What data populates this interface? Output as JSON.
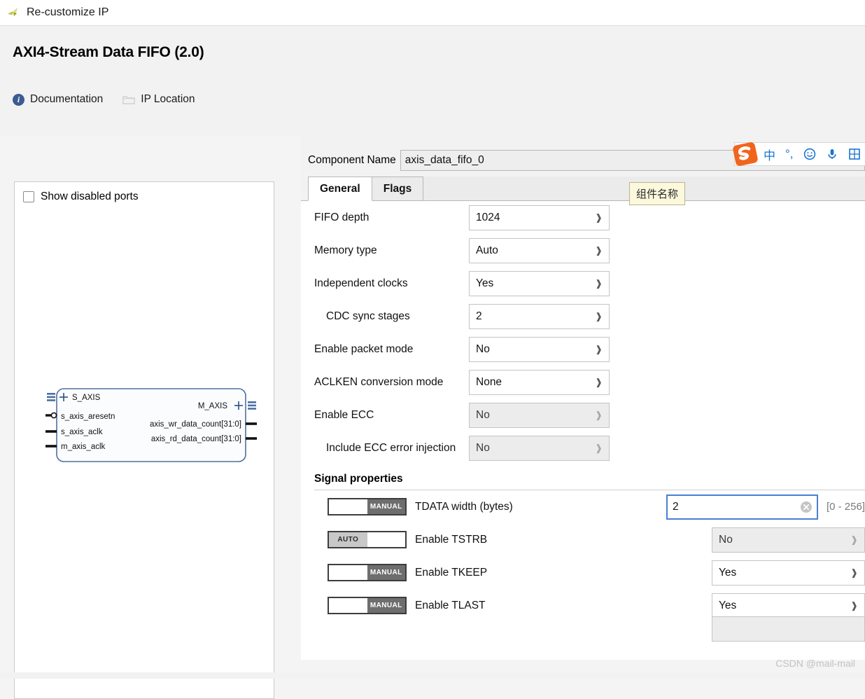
{
  "window": {
    "title": "Re-customize IP",
    "icon": "vivado-logo-icon"
  },
  "header": {
    "ip_title": "AXI4-Stream Data FIFO (2.0)",
    "links": [
      {
        "label": "Documentation",
        "icon": "info-icon"
      },
      {
        "label": "IP Location",
        "icon": "folder-icon"
      }
    ]
  },
  "left_panel": {
    "show_disabled_ports": {
      "label": "Show disabled ports",
      "checked": false
    },
    "symbol": {
      "left_ports": [
        "s_axis_aresetn",
        "s_axis_aclk",
        "m_axis_aclk"
      ],
      "left_bus": "S_AXIS",
      "right_bus": "M_AXIS",
      "right_ports": [
        "axis_wr_data_count[31:0]",
        "axis_rd_data_count[31:0]"
      ]
    }
  },
  "right_panel": {
    "component_name": {
      "label": "Component Name",
      "value": "axis_data_fifo_0",
      "placeholder": "axis_data_fifo_0"
    },
    "tabs": [
      {
        "label": "General",
        "active": true
      },
      {
        "label": "Flags",
        "active": false
      }
    ],
    "general_fields": [
      {
        "label": "FIFO depth",
        "value": "1024",
        "indent": false,
        "disabled": false
      },
      {
        "label": "Memory type",
        "value": "Auto",
        "indent": false,
        "disabled": false
      },
      {
        "label": "Independent clocks",
        "value": "Yes",
        "indent": false,
        "disabled": false
      },
      {
        "label": "CDC sync stages",
        "value": "2",
        "indent": true,
        "disabled": false
      },
      {
        "label": "Enable packet mode",
        "value": "No",
        "indent": false,
        "disabled": false
      },
      {
        "label": "ACLKEN conversion mode",
        "value": "None",
        "indent": false,
        "disabled": false
      },
      {
        "label": "Enable ECC",
        "value": "No",
        "indent": false,
        "disabled": true
      },
      {
        "label": "Include ECC error injection",
        "value": "No",
        "indent": true,
        "disabled": true
      }
    ],
    "signal_properties": {
      "title": "Signal properties",
      "rows": [
        {
          "toggle_mode": "MANUAL",
          "label": "TDATA width (bytes)",
          "control": "text",
          "value": "2",
          "range_hint": "[0 - 256]",
          "disabled": false
        },
        {
          "toggle_mode": "AUTO",
          "label": "Enable TSTRB",
          "control": "combo",
          "value": "No",
          "range_hint": "",
          "disabled": true
        },
        {
          "toggle_mode": "MANUAL",
          "label": "Enable TKEEP",
          "control": "combo",
          "value": "Yes",
          "range_hint": "",
          "disabled": false
        },
        {
          "toggle_mode": "MANUAL",
          "label": "Enable TLAST",
          "control": "combo",
          "value": "Yes",
          "range_hint": "",
          "disabled": false
        }
      ]
    }
  },
  "tooltip": {
    "text": "组件名称"
  },
  "ime_toolbar": {
    "logo": "sogou-logo-icon",
    "items": [
      {
        "glyph": "中",
        "name": "chinese-mode-icon"
      },
      {
        "glyph": "°,",
        "name": "punctuation-mode-icon"
      },
      {
        "glyph": "☺",
        "name": "emoji-icon"
      },
      {
        "glyph": "🎤",
        "name": "voice-input-icon"
      },
      {
        "glyph": "⊞",
        "name": "toolbox-icon"
      }
    ]
  },
  "watermark": {
    "text": "CSDN @mail-mail"
  },
  "colors": {
    "accent_blue": "#4a7fd4",
    "ime_blue": "#1a74d2",
    "sogou_orange": "#f1641e",
    "tooltip_bg": "#fbf8dc",
    "panel_bg": "#f2f2f2"
  }
}
